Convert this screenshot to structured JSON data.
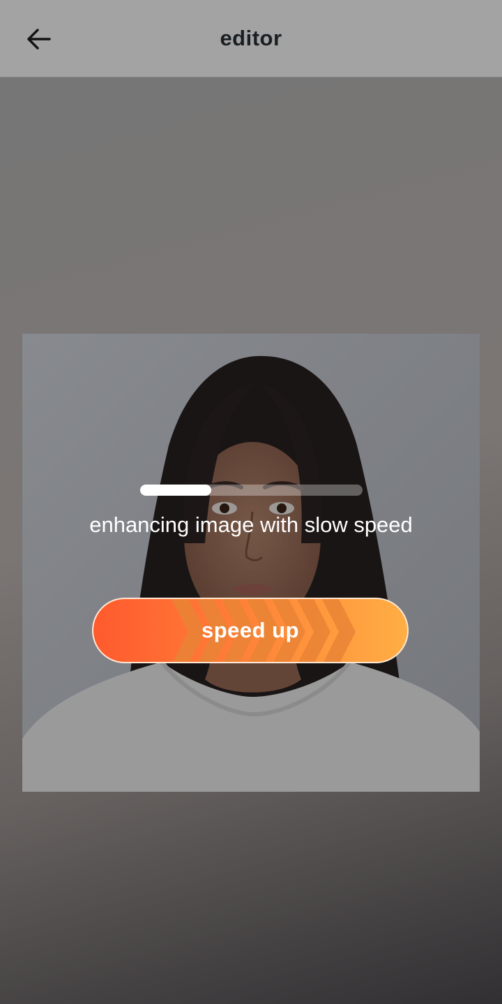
{
  "header": {
    "title": "editor",
    "back_icon": "arrow-left-icon"
  },
  "dialog": {
    "progress_fraction": 0.32,
    "status_text": "enhancing image with slow speed",
    "speed_up_label": "speed up"
  },
  "colors": {
    "accent_start": "#ff5a2e",
    "accent_end": "#ffae44"
  }
}
